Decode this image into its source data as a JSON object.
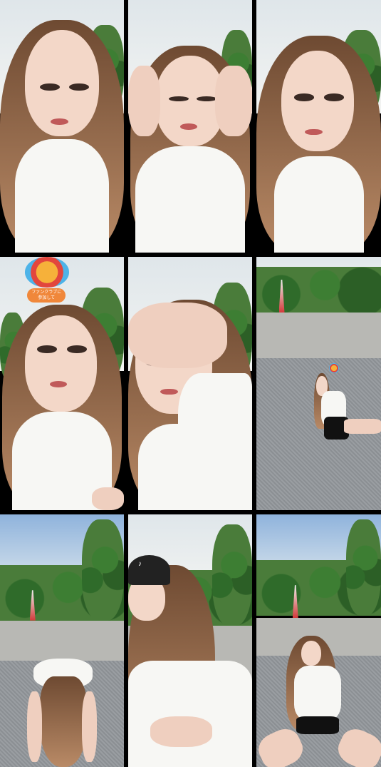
{
  "frames": [
    {
      "id": "frame-1",
      "scene": "closeup"
    },
    {
      "id": "frame-2",
      "scene": "closeup-hands"
    },
    {
      "id": "frame-3",
      "scene": "closeup"
    },
    {
      "id": "frame-4",
      "scene": "closeup-sticker"
    },
    {
      "id": "frame-5",
      "scene": "closeup-hand-forehead"
    },
    {
      "id": "frame-6",
      "scene": "sitting-on-ground"
    },
    {
      "id": "frame-7",
      "scene": "bending-over"
    },
    {
      "id": "frame-8",
      "scene": "cap-closeup"
    },
    {
      "id": "frame-9",
      "scene": "wide-stance"
    }
  ],
  "sticker": {
    "caption": "ファンクラブに\n参加して"
  },
  "cap_logo": "♪",
  "colors": {
    "hair": "#8a5e3f",
    "shirt": "#f7f7f4",
    "sky": "#e8ecee",
    "trees": "#3d7e33",
    "tower": "#d23a3a",
    "pill": "#f0873a"
  }
}
